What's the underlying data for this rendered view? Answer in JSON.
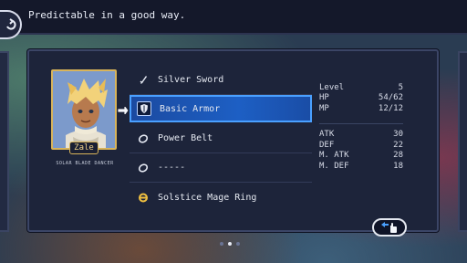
{
  "header": {
    "hint_text": "Predictable in a good way."
  },
  "character": {
    "name": "Zale",
    "class_title": "SOLAR BLADE DANCER"
  },
  "equipment": [
    {
      "label": "Silver Sword",
      "icon": "sword-icon",
      "selected": false
    },
    {
      "label": "Basic Armor",
      "icon": "armor-icon",
      "selected": true
    },
    {
      "label": "Power Belt",
      "icon": "belt-icon",
      "selected": false
    },
    {
      "label": "-----",
      "icon": "empty-accessory-icon",
      "selected": false
    },
    {
      "label": "Solstice Mage Ring",
      "icon": "ring-icon",
      "selected": false
    }
  ],
  "stats": {
    "level_label": "Level",
    "level_value": "5",
    "hp_label": "HP",
    "hp_value": "54/62",
    "mp_label": "MP",
    "mp_value": "12/12",
    "atk_label": "ATK",
    "atk_value": "30",
    "def_label": "DEF",
    "def_value": "22",
    "matk_label": "M. ATK",
    "matk_value": "28",
    "mdef_label": "M. DEF",
    "mdef_value": "18"
  },
  "pagination": {
    "total": 3,
    "active_index": 1
  },
  "colors": {
    "accent": "#1d5fc4",
    "gold": "#d8b45a",
    "panel": "#1d243a"
  }
}
